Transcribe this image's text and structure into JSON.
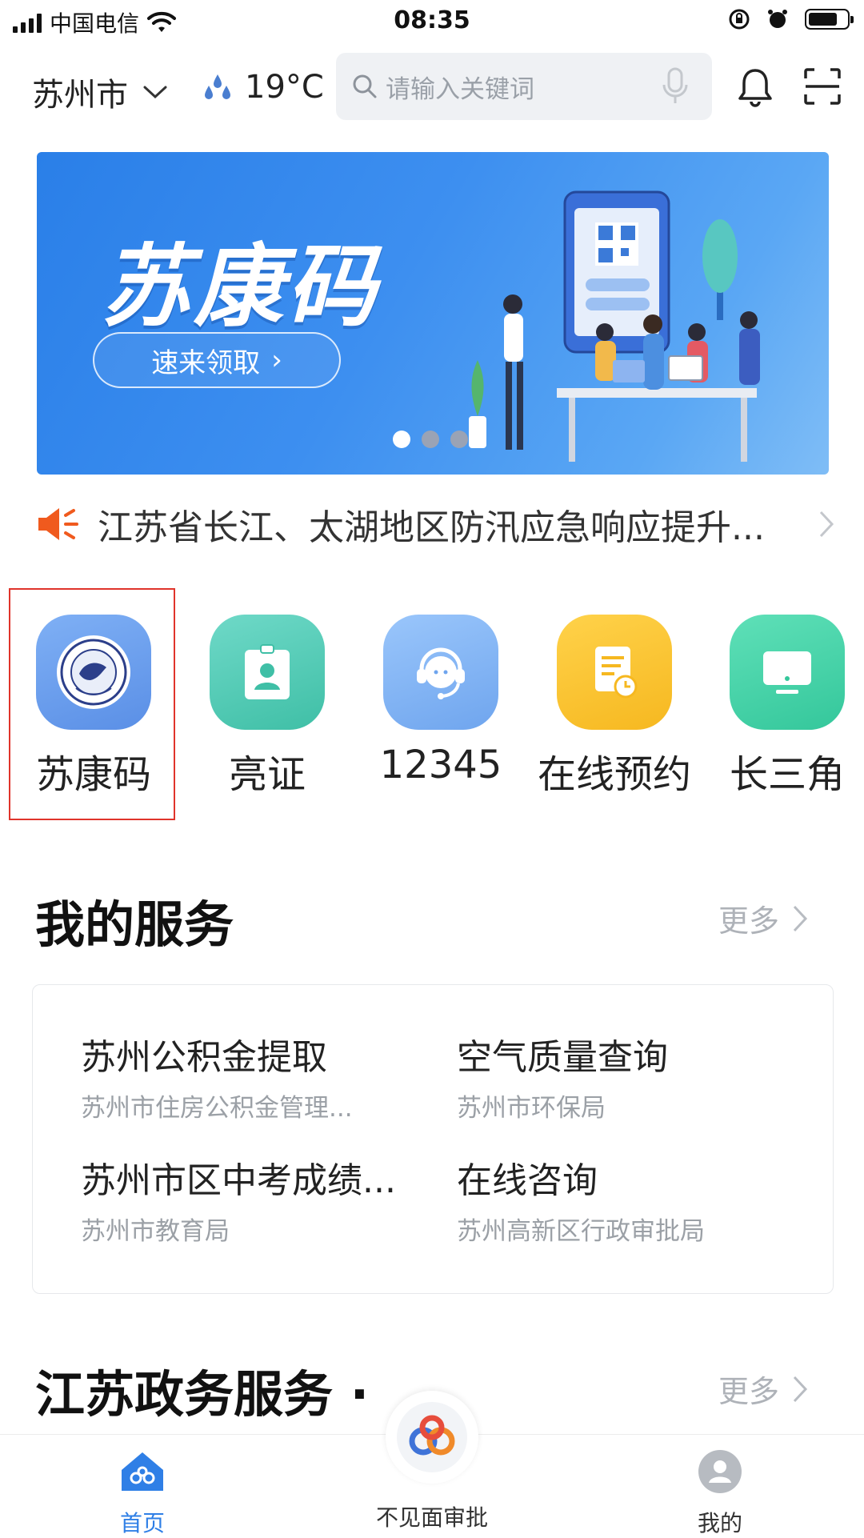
{
  "status_bar": {
    "carrier": "中国电信",
    "time": "08:35",
    "battery_level": 0.75
  },
  "header": {
    "city": "苏州市",
    "temperature": "19°C",
    "search_placeholder": "请输入关键词"
  },
  "banner": {
    "title": "苏康码",
    "button_label": "速来领取",
    "page_count": 3,
    "active_page": 1
  },
  "notice": {
    "text": "江苏省长江、太湖地区防汛应急响应提升..."
  },
  "quick_apps": [
    {
      "label": "苏康码",
      "icon": "health-code-emblem-icon"
    },
    {
      "label": "亮证",
      "icon": "id-badge-icon"
    },
    {
      "label": "12345",
      "icon": "customer-service-headset-icon"
    },
    {
      "label": "在线预约",
      "icon": "appointment-document-icon"
    },
    {
      "label": "长三角",
      "icon": "monitor-icon"
    }
  ],
  "my_services": {
    "title": "我的服务",
    "more": "更多",
    "items": [
      {
        "title": "苏州公积金提取",
        "subtitle": "苏州市住房公积金管理..."
      },
      {
        "title": "空气质量查询",
        "subtitle": "苏州市环保局"
      },
      {
        "title": "苏州市区中考成绩...",
        "subtitle": "苏州市教育局"
      },
      {
        "title": "在线咨询",
        "subtitle": "苏州高新区行政审批局"
      }
    ]
  },
  "jiangsu_services": {
    "title": "江苏政务服务 ·",
    "more": "更多"
  },
  "bottom_nav": {
    "home": "首页",
    "center": "不见面审批",
    "mine": "我的"
  },
  "colors": {
    "accent_blue": "#2f7fe6",
    "highlight_red": "#e0342b",
    "notice_orange": "#f05a1e"
  }
}
